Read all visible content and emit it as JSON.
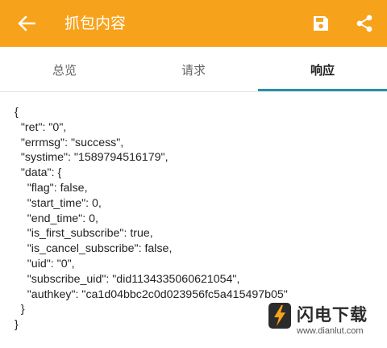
{
  "appbar": {
    "title": "抓包内容",
    "back_icon": "arrow-left-icon",
    "save_icon": "save-icon",
    "share_icon": "share-icon",
    "bg_color": "#f7a21b"
  },
  "tabs": [
    {
      "label": "总览",
      "selected": false
    },
    {
      "label": "请求",
      "selected": false
    },
    {
      "label": "响应",
      "selected": true
    }
  ],
  "accent_color": "#2c8fa8",
  "response_lines": [
    "{",
    "  \"ret\": \"0\",",
    "  \"errmsg\": \"success\",",
    "  \"systime\": \"1589794516179\",",
    "  \"data\": {",
    "    \"flag\": false,",
    "    \"start_time\": 0,",
    "    \"end_time\": 0,",
    "    \"is_first_subscribe\": true,",
    "    \"is_cancel_subscribe\": false,",
    "    \"uid\": \"0\",",
    "    \"subscribe_uid\": \"did1134335060621054\",",
    "    \"authkey\": \"ca1d04bbc2c0d023956fc5a415497b05\"",
    "  }",
    "}"
  ],
  "watermark": {
    "brand": "闪电下载",
    "url": "www.dianlut.com"
  }
}
